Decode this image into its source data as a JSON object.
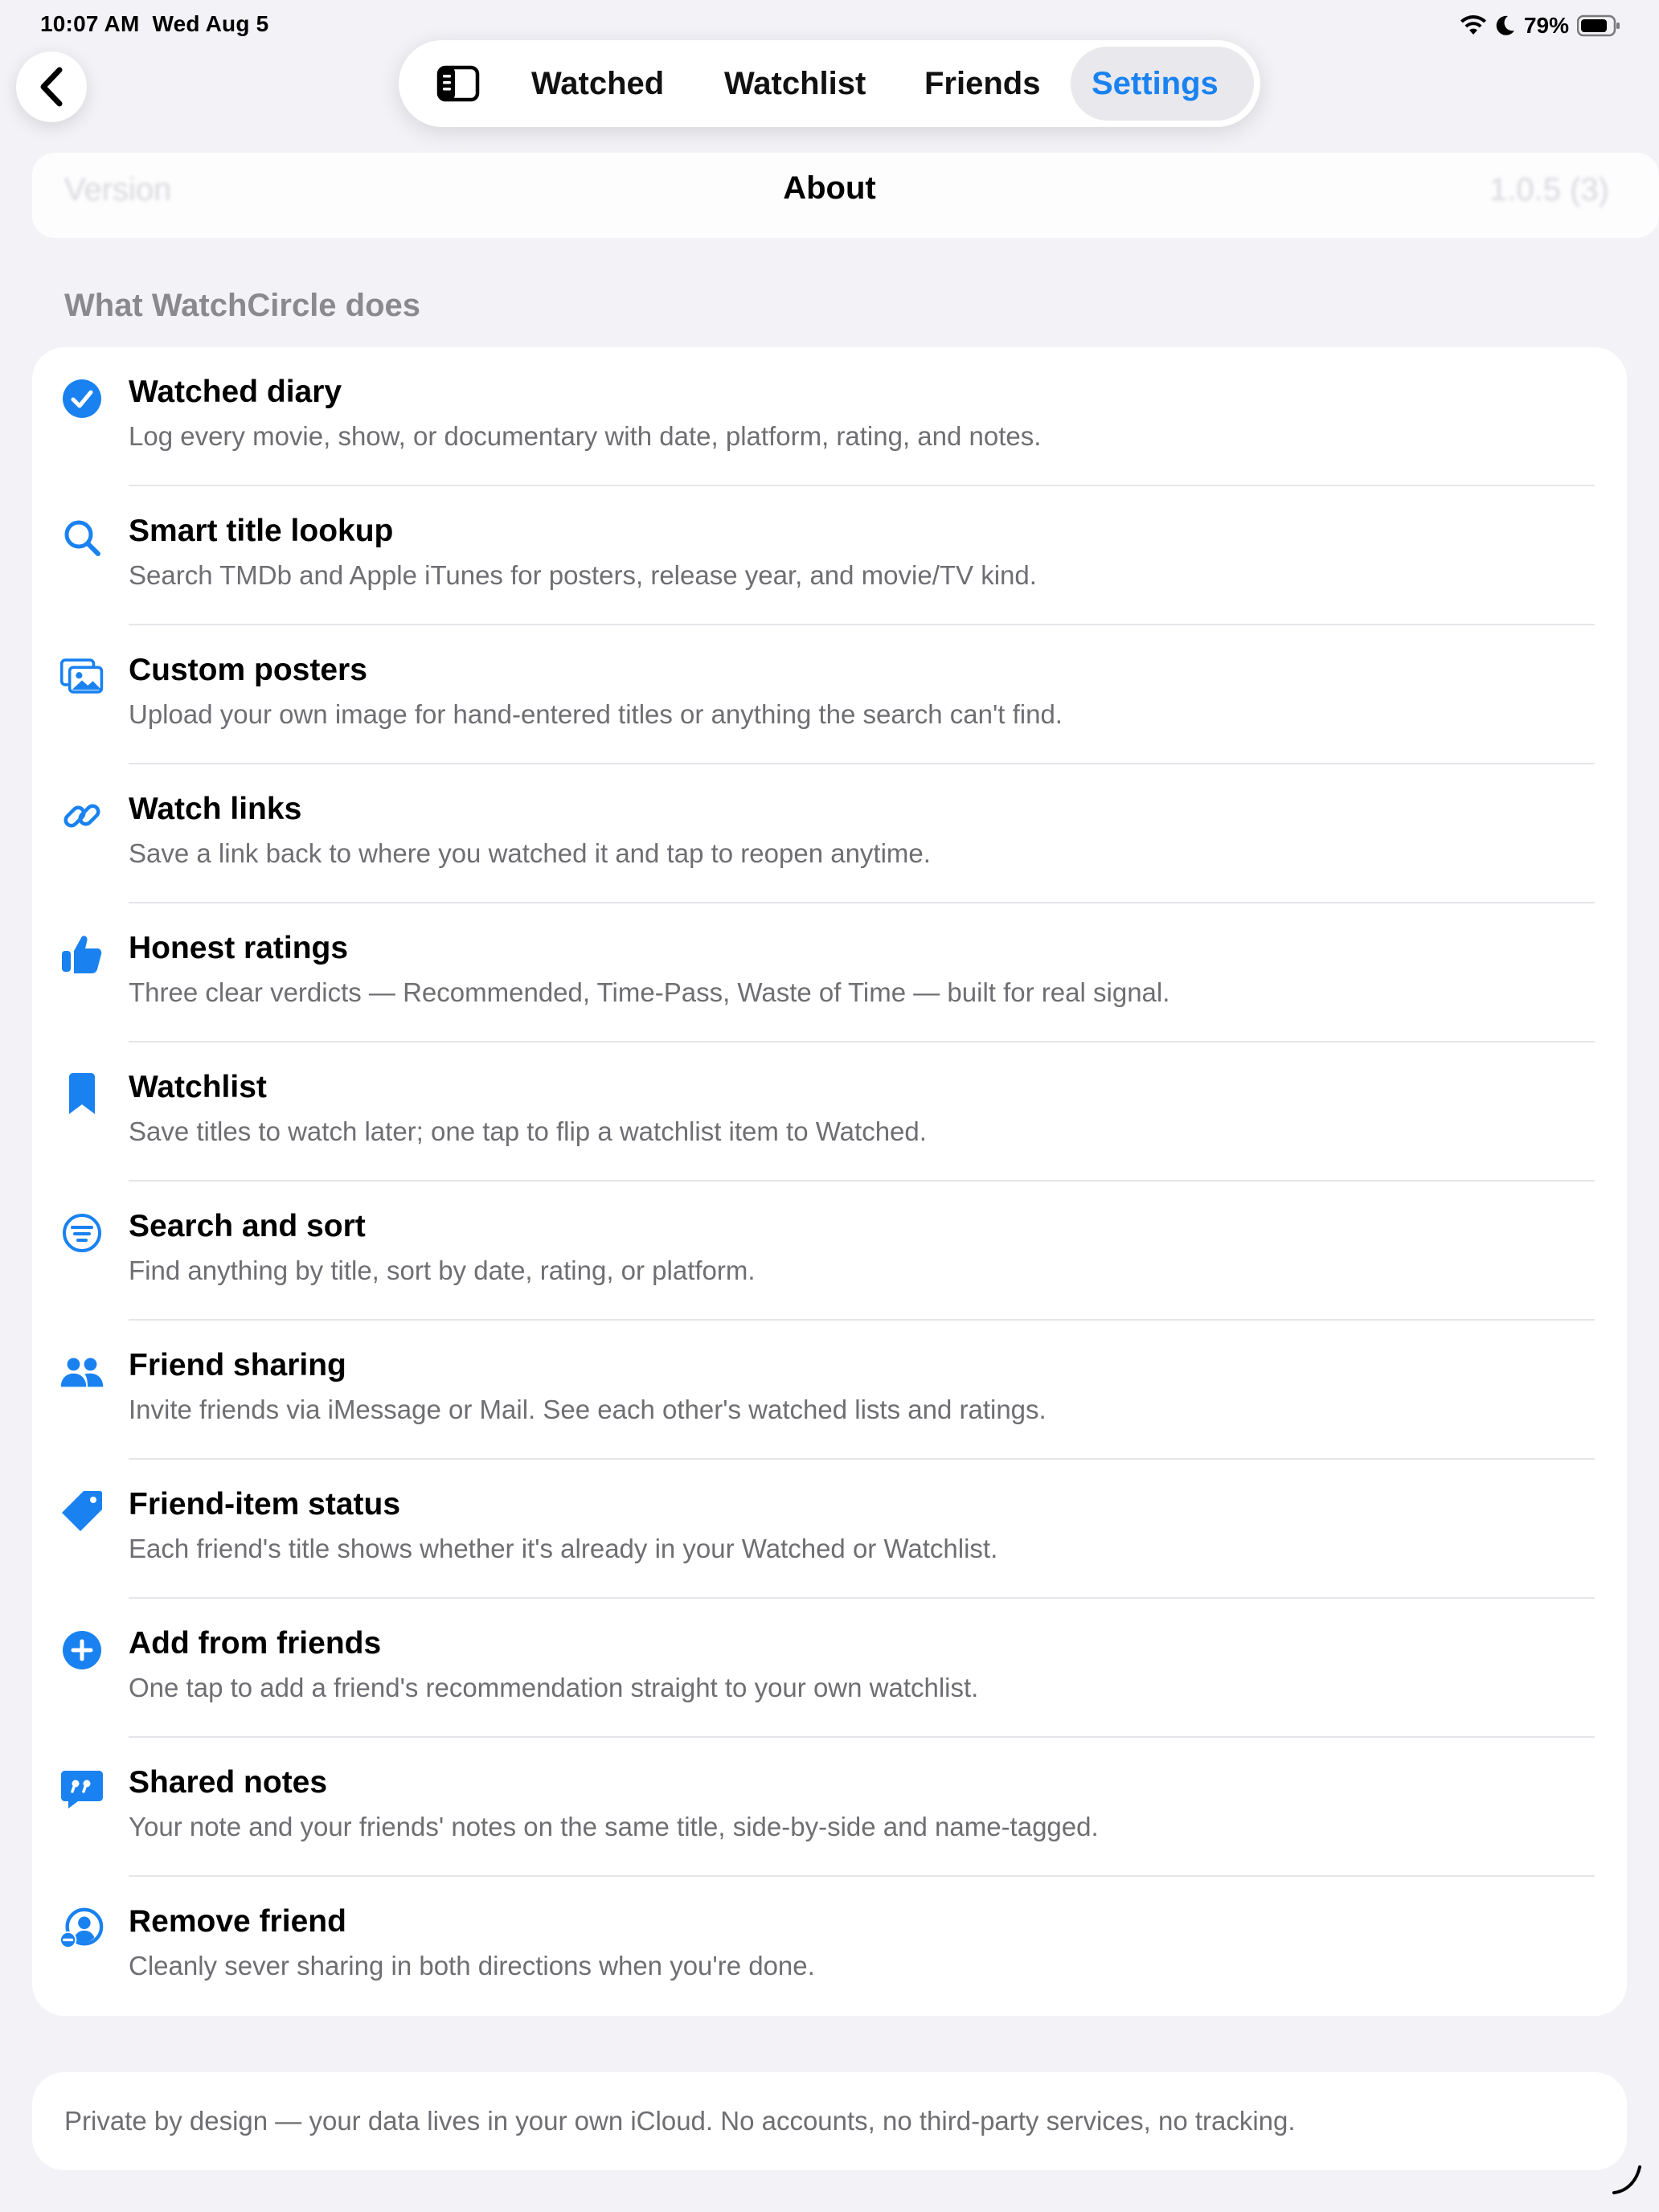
{
  "status_bar": {
    "time": "10:07 AM",
    "date": "Wed Aug 5",
    "battery": "79%"
  },
  "nav": {
    "tabs": [
      {
        "label": "Watched"
      },
      {
        "label": "Watchlist"
      },
      {
        "label": "Friends"
      },
      {
        "label": "Settings",
        "selected": true
      }
    ],
    "title": "About"
  },
  "version_row": {
    "label": "Version",
    "value": "1.0.5 (3)"
  },
  "section": {
    "header": "What WatchCircle does"
  },
  "features": [
    {
      "icon": "checkmark-circle-icon",
      "title": "Watched diary",
      "subtitle": "Log every movie, show, or documentary with date, platform, rating, and notes."
    },
    {
      "icon": "magnifying-glass-icon",
      "title": "Smart title lookup",
      "subtitle": "Search TMDb and Apple iTunes for posters, release year, and movie/TV kind."
    },
    {
      "icon": "photos-icon",
      "title": "Custom posters",
      "subtitle": "Upload your own image for hand-entered titles or anything the search can't find."
    },
    {
      "icon": "link-icon",
      "title": "Watch links",
      "subtitle": "Save a link back to where you watched it and tap to reopen anytime."
    },
    {
      "icon": "thumbs-up-icon",
      "title": "Honest ratings",
      "subtitle": "Three clear verdicts — Recommended, Time-Pass, Waste of Time — built for real signal."
    },
    {
      "icon": "bookmark-icon",
      "title": "Watchlist",
      "subtitle": "Save titles to watch later; one tap to flip a watchlist item to Watched."
    },
    {
      "icon": "filter-circle-icon",
      "title": "Search and sort",
      "subtitle": "Find anything by title, sort by date, rating, or platform."
    },
    {
      "icon": "people-icon",
      "title": "Friend sharing",
      "subtitle": "Invite friends via iMessage or Mail. See each other's watched lists and ratings."
    },
    {
      "icon": "tag-icon",
      "title": "Friend-item status",
      "subtitle": "Each friend's title shows whether it's already in your Watched or Watchlist."
    },
    {
      "icon": "plus-circle-icon",
      "title": "Add from friends",
      "subtitle": "One tap to add a friend's recommendation straight to your own watchlist."
    },
    {
      "icon": "quote-bubble-icon",
      "title": "Shared notes",
      "subtitle": "Your note and your friends' notes on the same title, side-by-side and name-tagged."
    },
    {
      "icon": "person-remove-icon",
      "title": "Remove friend",
      "subtitle": "Cleanly sever sharing in both directions when you're done."
    }
  ],
  "footer": {
    "text": "Private by design — your data lives in your own iCloud. No accounts, no third-party services, no tracking."
  },
  "colors": {
    "accent": "#1a82f0",
    "background": "#f2f2f7",
    "secondary_text": "#6e6e73"
  }
}
